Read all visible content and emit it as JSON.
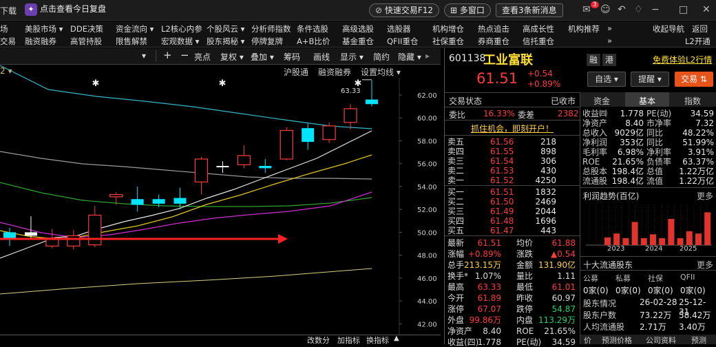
{
  "titlebar": {
    "download": "下载",
    "promo": "点击查看今日复盘",
    "quick_trade": "快速交易F12",
    "multi_window": "多窗口",
    "news": "查看3条新消息",
    "badge": "3"
  },
  "menu": {
    "row1": [
      "场",
      "美股市场 ▾",
      "DDE决策",
      "资金流向 ▾",
      "L2核心内参",
      "个股风云 ▾",
      "分析师指数",
      "条件选股",
      "高级选股",
      "选股器",
      "机构增仓",
      "热点追击",
      "高成长性",
      "机构推荐",
      "»",
      "收起导航",
      "返回"
    ],
    "row2": [
      "交易",
      "融资融券",
      "高管持股",
      "限售解禁",
      "宏观数据 ▾",
      "股东揭秘 ▾",
      "停牌复牌",
      "A+B比价",
      "基金重仓",
      "QFII重仓",
      "社保重仓",
      "券商重仓",
      "信托重仓",
      "»",
      "L2开通"
    ]
  },
  "toolbar": {
    "items": [
      "▾",
      "|",
      "+",
      "−",
      "亮点",
      "复权 ▾",
      "叠加 ▾",
      "筹码",
      "画线",
      "显示 ▾",
      "简约",
      "隐藏 ▾"
    ],
    "sub_left": "2 ▾",
    "sub_items": [
      "沪股通",
      "融资融券",
      "设置均线 ▾"
    ]
  },
  "chart_data": {
    "type": "candlestick",
    "y_ticks": [
      "62.00",
      "60.00",
      "58.00",
      "56.00",
      "54.00",
      "52.00",
      "50.00",
      "48.00",
      "46.00",
      "44.00",
      "42.00"
    ],
    "ylim": [
      41.0,
      63.5
    ],
    "high_annotation": "63.33",
    "candles": [
      {
        "o": 49.4,
        "c": 50.0,
        "h": 50.4,
        "l": 48.8,
        "t": "down"
      },
      {
        "o": 49.7,
        "c": 50.0,
        "h": 51.4,
        "l": 49.4,
        "t": "flat"
      },
      {
        "o": 48.8,
        "c": 49.5,
        "h": 50.3,
        "l": 48.6,
        "t": "up"
      },
      {
        "o": 48.8,
        "c": 49.7,
        "h": 50.2,
        "l": 48.5,
        "t": "up"
      },
      {
        "o": 48.9,
        "c": 51.5,
        "h": 52.3,
        "l": 48.7,
        "t": "up"
      },
      {
        "o": 53.1,
        "c": 53.3,
        "h": 53.5,
        "l": 52.4,
        "t": "up"
      },
      {
        "o": 52.9,
        "c": 52.4,
        "h": 54.0,
        "l": 51.8,
        "t": "down"
      },
      {
        "o": 52.9,
        "c": 52.5,
        "h": 53.3,
        "l": 52.2,
        "t": "down"
      },
      {
        "o": 52.5,
        "c": 53.0,
        "h": 53.9,
        "l": 52.0,
        "t": "down"
      },
      {
        "o": 54.4,
        "c": 56.4,
        "h": 56.6,
        "l": 53.3,
        "t": "up"
      },
      {
        "o": 55.7,
        "c": 55.8,
        "h": 56.2,
        "l": 55.2,
        "t": "flat"
      },
      {
        "o": 55.9,
        "c": 56.7,
        "h": 57.6,
        "l": 55.6,
        "t": "up"
      },
      {
        "o": 55.8,
        "c": 55.6,
        "h": 56.4,
        "l": 55.2,
        "t": "down"
      },
      {
        "o": 56.4,
        "c": 58.9,
        "h": 59.2,
        "l": 56.3,
        "t": "up"
      },
      {
        "o": 59.1,
        "c": 57.9,
        "h": 59.5,
        "l": 57.2,
        "t": "down"
      },
      {
        "o": 58.1,
        "c": 59.3,
        "h": 59.6,
        "l": 57.8,
        "t": "up"
      },
      {
        "o": 59.6,
        "c": 60.8,
        "h": 61.2,
        "l": 59.0,
        "t": "up"
      },
      {
        "o": 61.2,
        "c": 61.6,
        "h": 63.3,
        "l": 61.0,
        "t": "down"
      }
    ],
    "stars_x": [
      "139",
      "323",
      "520"
    ]
  },
  "bottombar": [
    "改数分",
    "加指标",
    "换指标",
    "▲"
  ],
  "stock": {
    "code": "601138",
    "name": "工业富联",
    "price": "61.51",
    "change": "+0.54",
    "change_pct": "+0.89%",
    "tags": [
      "融",
      "港"
    ],
    "l2": "免费体验L2行情",
    "watch": "自选 ▾",
    "remind": "提醒 ▾",
    "trade": "交易 ⇅"
  },
  "tabs": [
    "资金",
    "基本",
    "指数"
  ],
  "status": {
    "label": "交易状态",
    "value": "已收市"
  },
  "ratio": {
    "l1": "委比",
    "v1": "16.33%",
    "l2": "委差",
    "v2": "2382"
  },
  "promo2": "抓住机会，即刻开户！",
  "sells": [
    {
      "n": "卖五",
      "p": "61.56",
      "v": "218"
    },
    {
      "n": "卖四",
      "p": "61.55",
      "v": "898"
    },
    {
      "n": "卖三",
      "p": "61.54",
      "v": "306"
    },
    {
      "n": "卖二",
      "p": "61.53",
      "v": "430"
    },
    {
      "n": "卖一",
      "p": "61.52",
      "v": "4250"
    }
  ],
  "buys": [
    {
      "n": "买一",
      "p": "61.51",
      "v": "1832"
    },
    {
      "n": "买二",
      "p": "61.50",
      "v": "2469"
    },
    {
      "n": "买三",
      "p": "61.49",
      "v": "2044"
    },
    {
      "n": "买四",
      "p": "61.48",
      "v": "1696"
    },
    {
      "n": "买五",
      "p": "61.47",
      "v": "443"
    }
  ],
  "quote": [
    [
      "最新",
      "61.51",
      "均价",
      "61.88"
    ],
    [
      "涨幅",
      "+0.89%",
      "涨跌",
      "▲0.54"
    ],
    [
      "总手",
      "213.15万",
      "金额",
      "131.90亿"
    ],
    [
      "换手*",
      "1.07%",
      "量比",
      "1.11"
    ],
    [
      "最高",
      "63.33",
      "最低",
      "61.01"
    ],
    [
      "今开",
      "61.89",
      "昨收",
      "60.97"
    ],
    [
      "涨停",
      "67.07",
      "跌停",
      "54.87"
    ],
    [
      "外盘",
      "99.86万",
      "内盘",
      "113.29万"
    ],
    [
      "净资产",
      "8.40",
      "ROE",
      "21.65%"
    ],
    [
      "收益(四)",
      "1.778",
      "PE(动)",
      "34.59"
    ]
  ],
  "fundamentals": [
    [
      "收益㈣",
      "1.778",
      "PE(动)",
      "34.59"
    ],
    [
      "净资产",
      "8.40",
      "市净率",
      "7.32"
    ],
    [
      "总收入",
      "9029亿",
      "同比",
      "48.22%"
    ],
    [
      "净利润",
      "353亿",
      "同比",
      "51.99%"
    ],
    [
      "毛利率",
      "6.98%",
      "净利率",
      "3.91%"
    ],
    [
      "ROE",
      "21.65%",
      "负债率",
      "63.37%"
    ],
    [
      "总股本",
      "198.4亿",
      "总值",
      "1.22万亿"
    ],
    [
      "流通股",
      "198.4亿",
      "流值",
      "1.22万亿"
    ]
  ],
  "profit": {
    "title": "利润趋势(百亿)",
    "more": "更多",
    "years": [
      "2023",
      "2024",
      "2025"
    ],
    "bars": [
      0.2,
      0.3,
      0.18,
      0.6,
      0.18,
      0.28,
      0.18,
      0.68,
      0.18,
      0.36,
      0.3,
      0.85
    ]
  },
  "holders": {
    "title": "十大流通股东",
    "more": "更多",
    "cols": [
      "公募",
      "私募",
      "社保",
      "QFII"
    ],
    "vals": [
      "0家(0)",
      "0家(0)",
      "0家(0)",
      "0家(0)"
    ],
    "rows": [
      [
        "股东情况",
        "26-02-28",
        "25-12-31"
      ],
      [
        "股东户数",
        "73.22万",
        "58.42万"
      ],
      [
        "人均流通股",
        "2.71万",
        "3.40万"
      ]
    ]
  },
  "bottom_tabs": [
    "价",
    "预测价格",
    "公司资料",
    "预测"
  ]
}
